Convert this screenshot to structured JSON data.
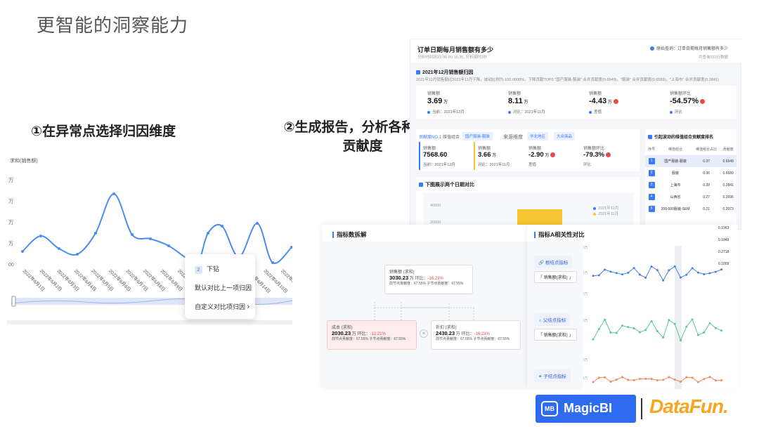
{
  "slide": {
    "title": "更智能的洞察能力",
    "step1": "①在异常点选择归因维度",
    "step2": "②生成报告，分析各种组合贡献度"
  },
  "left_chart": {
    "ylabel": "求和(销售额)",
    "yticks": [
      "万",
      "万",
      "万",
      "万",
      "00"
    ],
    "xticks": [
      "2022年6月1日",
      "2022年6月2日",
      "2022年6月3日",
      "2022年6月4日",
      "2022年6月5日",
      "2022年6月6日",
      "2022年6月7日",
      "2022年6月8日",
      "2022年6月9日",
      "2022年6月10日",
      "2022年6月11日",
      "2022年6月12日",
      "2022年6月13日",
      "2022年6月14日",
      "2022年6月15日",
      "2022年6月16日",
      "2022年6月17日"
    ],
    "line_color": "#4a8df0",
    "context_menu": {
      "drill_badge": "2",
      "drill": "下钻",
      "default_compare": "默认对比上一项归因",
      "custom_compare": "自定义对比项归因",
      "custom_arrow": "›"
    }
  },
  "report": {
    "title": "订单日期每月销售额有多少",
    "meta": "分析时间2023-06-09 16:35, 分析用时2秒",
    "query_label": "原始查询：订单日期每月销售额有多少",
    "query_sub": "共查询222行数据",
    "section1": "2021年12月销售额归因",
    "section1_desc": "2021年12月销售额比2021年11月下降，波动比例为-100.0000%，下降贡献TOP3 \"国产服装-服装\" 合并贡献度(0.6549)，\"服装\" 合并贡献度(0.6589)，\"上海市\" 合并贡献度(0.2841)",
    "kpis": [
      {
        "label": "销售额",
        "value": "3.69",
        "unit": "万",
        "sub": "当前：2021年12月"
      },
      {
        "label": "销售额",
        "value": "8.11",
        "unit": "万",
        "sub": "对比：2021年11月"
      },
      {
        "label": "销售额",
        "value": "-4.43",
        "unit": "万",
        "sub": "差值"
      },
      {
        "label": "销售额环比",
        "value": "-54.57%",
        "unit": "",
        "sub": "环比"
      }
    ],
    "combo_row": {
      "label1": "贡献度NO.1",
      "label2": "维值组合",
      "tag1": "国产服装-服装",
      "label3": "来源维度",
      "tag2": "华北地区",
      "tag3": "大众商品"
    },
    "kpis2": [
      {
        "label": "销售额",
        "value": "7568.60",
        "sub": "当前：2021年12月"
      },
      {
        "label": "销售额",
        "value": "3.66",
        "unit": "万",
        "sub": "对比：2021年11月"
      },
      {
        "label": "销售额",
        "value": "-2.90",
        "unit": "万",
        "sub": "差值"
      },
      {
        "label": "销售额环比",
        "value": "-79.3%",
        "sub": "环比"
      }
    ],
    "section2": "下图展示两个日期对比",
    "bar_axis": [
      "40000",
      "20000"
    ],
    "bar_legend": [
      "2021年12月",
      "2021年11月"
    ],
    "rank_title": "引起波动的维值组合贡献度排名",
    "rank_headers": [
      "序号",
      "维值组合",
      "维值组合占比",
      "贡献度"
    ],
    "rank_rows": [
      [
        "1",
        "国产服装-服装",
        "0.37",
        "0.6549"
      ],
      [
        "2",
        "服装",
        "0.36",
        "0.6589"
      ],
      [
        "3",
        "上海市",
        "0.28",
        "0.2841"
      ],
      [
        "4",
        "山西省",
        "0.27",
        "0.2696"
      ],
      [
        "5",
        "200-500服装-SEM",
        "0.21",
        "0.2073"
      ]
    ],
    "rank_extra": [
      "0.1963",
      "0.1849",
      "0.2718",
      "0.1009"
    ]
  },
  "decomp": {
    "title": "指标数拆解",
    "root": {
      "name": "销售额 (求和)",
      "value": "3030.23",
      "unit": "万",
      "mom_label": "环比：",
      "mom": "-16.23%",
      "contrib1": "前节点贡献度：67.55%",
      "contrib2": "子节点贡献度：67.55%"
    },
    "left": {
      "name": "成本 (求和)",
      "value": "2030.23",
      "unit": "万",
      "mom_label": "环比：",
      "mom": "-12.21%",
      "contrib1": "前节点贡献度：67.55%",
      "contrib2": "子节点贡献度：67.55%"
    },
    "right": {
      "name": "折扣 (求和)",
      "value": "2430.23",
      "unit": "万",
      "mom_label": "环比：",
      "mom": "-16.23%",
      "contrib1": "前节点贡献度：67.55%",
      "contrib2": "子节点贡献度：67.55%"
    },
    "operator": "×"
  },
  "corr": {
    "title": "指标A相关性对比",
    "btn1": "根结点指标",
    "lbl1": "「 销售额(求和) 」",
    "btn2": "父结点指标",
    "lbl2": "「 销售额(求和) 」",
    "btn3": "子结点指标",
    "axis": [
      "20万",
      "15万",
      "20万",
      "10万",
      "0",
      "20万",
      "15万"
    ],
    "colors": [
      "#4a7fe0",
      "#5cc79a",
      "#f08a5d"
    ]
  },
  "logos": {
    "magicbi": "MagicBI",
    "datafun": "DataFun."
  }
}
